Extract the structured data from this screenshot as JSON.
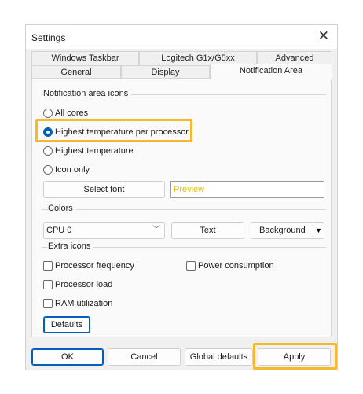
{
  "window": {
    "title": "Settings",
    "close_glyph": "✕"
  },
  "tabs_row1": [
    "Windows Taskbar",
    "Logitech G1x/G5xx",
    "Advanced"
  ],
  "tabs_row2": [
    "General",
    "Display",
    "Notification Area"
  ],
  "active_tab": "Notification Area",
  "notification": {
    "label": "Notification area icons",
    "options": [
      "All cores",
      "Highest temperature per processor",
      "Highest temperature",
      "Icon only"
    ],
    "selected": "Highest temperature per processor",
    "select_font_label": "Select font",
    "preview_text": "Preview"
  },
  "colors": {
    "label": "Colors",
    "cpu_select_value": "CPU 0",
    "text_button": "Text",
    "background_button": "Background",
    "dropdown_glyph": "▼",
    "chevron_glyph": "﹀"
  },
  "extra_icons": {
    "label": "Extra icons",
    "processor_frequency": "Processor frequency",
    "power_consumption": "Power consumption",
    "processor_load": "Processor load",
    "ram_utilization": "RAM utilization",
    "checked": {
      "processor_frequency": false,
      "power_consumption": false,
      "processor_load": false,
      "ram_utilization": false
    }
  },
  "defaults_label": "Defaults",
  "footer": {
    "ok": "OK",
    "cancel": "Cancel",
    "global_defaults": "Global defaults",
    "apply": "Apply"
  },
  "accent_color": "#f5b82e"
}
